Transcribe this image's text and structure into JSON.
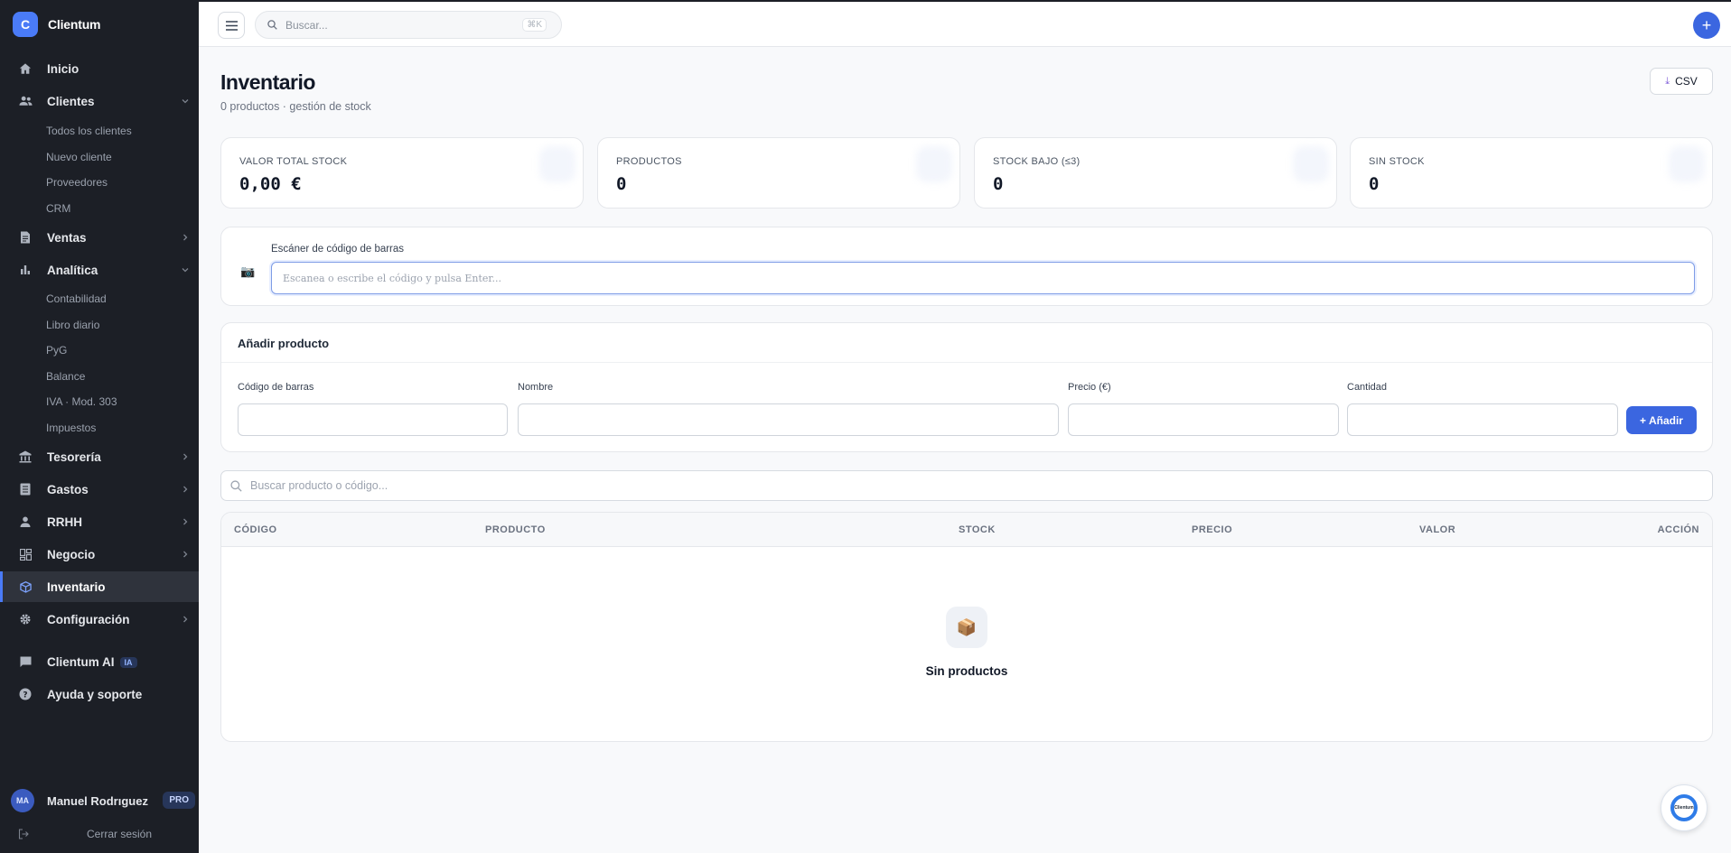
{
  "brand": {
    "logo_letter": "C",
    "name": "Clientum"
  },
  "sidebar": {
    "nav": [
      {
        "label": "Inicio",
        "icon": "home-icon"
      },
      {
        "label": "Clientes",
        "icon": "users-icon",
        "expanded": true
      },
      {
        "label": "Ventas",
        "icon": "document-icon"
      },
      {
        "label": "Analítica",
        "icon": "bar-chart-icon",
        "expanded": true
      },
      {
        "label": "Tesorería",
        "icon": "bank-icon"
      },
      {
        "label": "Gastos",
        "icon": "receipt-icon"
      },
      {
        "label": "RRHH",
        "icon": "person-icon"
      },
      {
        "label": "Negocio",
        "icon": "grid-icon"
      },
      {
        "label": "Inventario",
        "icon": "box-icon",
        "active": true
      },
      {
        "label": "Configuración",
        "icon": "gear-icon"
      },
      {
        "label": "Clientum AI",
        "icon": "chat-icon",
        "badge": "IA"
      },
      {
        "label": "Ayuda y soporte",
        "icon": "help-icon"
      }
    ],
    "clientes_sub": [
      "Todos los clientes",
      "Nuevo cliente",
      "Proveedores",
      "CRM"
    ],
    "analitica_sub": [
      "Contabilidad",
      "Libro diario",
      "PyG",
      "Balance",
      "IVA · Mod. 303",
      "Impuestos"
    ],
    "user": {
      "initials": "MA",
      "name": "Manuel Rodrıguez",
      "plan": "PRO"
    },
    "logout": "Cerrar sesión"
  },
  "topbar": {
    "search_placeholder": "Buscar...",
    "shortcut": "⌘K"
  },
  "page": {
    "title": "Inventario",
    "subtitle": "0 productos · gestión de stock",
    "csv_label": "CSV"
  },
  "stats": [
    {
      "label": "VALOR TOTAL STOCK",
      "value": "0,00 €"
    },
    {
      "label": "PRODUCTOS",
      "value": "0"
    },
    {
      "label": "STOCK BAJO (≤3)",
      "value": "0"
    },
    {
      "label": "SIN STOCK",
      "value": "0"
    }
  ],
  "scanner": {
    "label": "Escáner de código de barras",
    "placeholder": "Escanea o escribe el código y pulsa Enter..."
  },
  "add_product": {
    "title": "Añadir producto",
    "fields": {
      "barcode": "Código de barras",
      "name": "Nombre",
      "price": "Precio (€)",
      "quantity": "Cantidad"
    },
    "button": "+ Añadir"
  },
  "product_search": {
    "placeholder": "Buscar producto o código..."
  },
  "table": {
    "headers": [
      "CÓDIGO",
      "PRODUCTO",
      "STOCK",
      "PRECIO",
      "VALOR",
      "ACCIÓN"
    ],
    "empty_icon": "📦",
    "empty_text": "Sin productos"
  },
  "fab": {
    "label": "Clientum"
  },
  "colors": {
    "accent": "#3b66e0",
    "sidebar_bg": "#1c1f26"
  }
}
